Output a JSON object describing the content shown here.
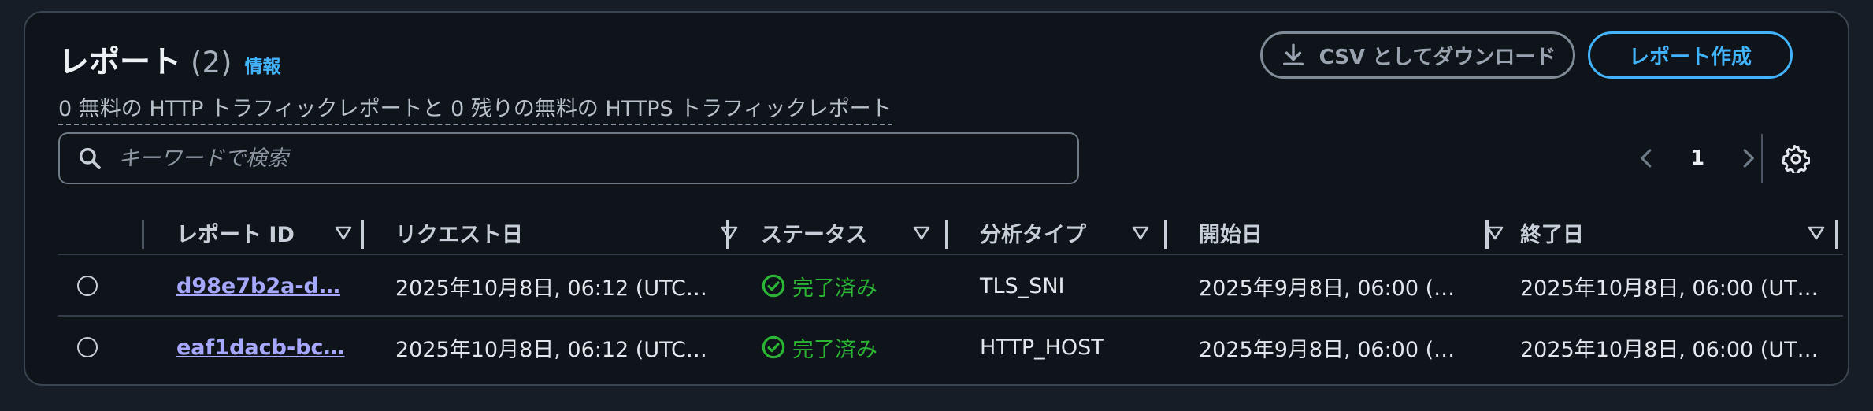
{
  "header": {
    "title": "レポート",
    "count": "(2)",
    "info_link": "情報",
    "subtitle": "0 無料の HTTP トラフィックレポートと 0 残りの無料の HTTPS トラフィックレポート"
  },
  "actions": {
    "csv_label": "CSV としてダウンロード",
    "create_label": "レポート作成"
  },
  "search": {
    "placeholder": "キーワードで検索",
    "value": ""
  },
  "pagination": {
    "current_page": "1"
  },
  "table": {
    "columns": [
      "レポート ID",
      "リクエスト日",
      "ステータス",
      "分析タイプ",
      "開始日",
      "終了日"
    ],
    "rows": [
      {
        "report_id": "d98e7b2a-d…",
        "request_date": "2025年10月8日, 06:12 (UTC…",
        "status": "完了済み",
        "analysis_type": "TLS_SNI",
        "start_date": "2025年9月8日, 06:00 (…",
        "end_date": "2025年10月8日, 06:00 (UT…"
      },
      {
        "report_id": "eaf1dacb-bc…",
        "request_date": "2025年10月8日, 06:12 (UTC…",
        "status": "完了済み",
        "analysis_type": "HTTP_HOST",
        "start_date": "2025年9月8日, 06:00 (…",
        "end_date": "2025年10月8日, 06:00 (UT…"
      }
    ]
  },
  "colors": {
    "background": "#161d26",
    "panel": "#0f141b",
    "accent": "#42b4ff",
    "link": "#a6a8ff",
    "success": "#2bb534"
  },
  "icons": [
    "download-icon",
    "search-icon",
    "chevron-left-icon",
    "chevron-right-icon",
    "settings-gear-icon",
    "sort-caret-icon",
    "success-check-icon"
  ]
}
